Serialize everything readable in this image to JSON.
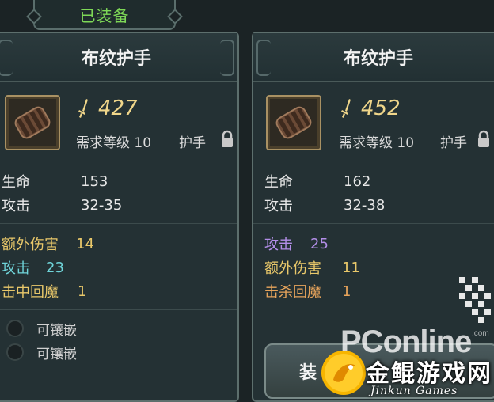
{
  "equipped_tab": "已装备",
  "left_item": {
    "name": "布纹护手",
    "power": "427",
    "requirement": "需求等级 10",
    "slot": "护手",
    "base_stats": [
      {
        "key": "生命",
        "value": "153",
        "color": "#e8e8e8"
      },
      {
        "key": "攻击",
        "value": "32-35",
        "color": "#e8e8e8"
      }
    ],
    "extra_stats": [
      {
        "key": "额外伤害",
        "value": "14",
        "color": "#e9c86a"
      },
      {
        "key": "攻击",
        "value": "23",
        "color": "#6fd4d9"
      },
      {
        "key": "击中回魔",
        "value": "1",
        "color": "#e9c86a"
      }
    ],
    "sockets": [
      "可镶嵌",
      "可镶嵌"
    ]
  },
  "right_item": {
    "name": "布纹护手",
    "power": "452",
    "requirement": "需求等级 10",
    "slot": "护手",
    "base_stats": [
      {
        "key": "生命",
        "value": "162",
        "color": "#e8e8e8"
      },
      {
        "key": "攻击",
        "value": "32-38",
        "color": "#e8e8e8"
      }
    ],
    "extra_stats": [
      {
        "key": "攻击",
        "value": "25",
        "color": "#b38ee8"
      },
      {
        "key": "额外伤害",
        "value": "11",
        "color": "#e9c86a"
      },
      {
        "key": "击杀回魔",
        "value": "1",
        "color": "#e7a45b"
      }
    ],
    "equip_button": "装"
  },
  "watermarks": {
    "pconline": "PConline",
    "pconline_com": ".com",
    "site_cn": "金鲲游戏网",
    "site_en": "Jinkun Games"
  }
}
